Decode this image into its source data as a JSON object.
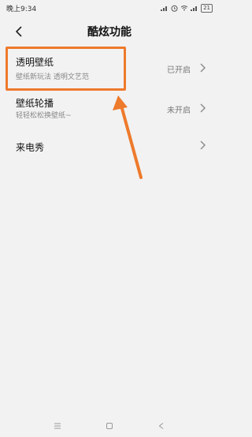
{
  "status_bar": {
    "time": "晚上9:34",
    "battery": "21",
    "icons": [
      "alarm-icon",
      "wifi-icon",
      "signal-icon",
      "signal-icon-2",
      "battery-icon"
    ]
  },
  "header": {
    "title": "酷炫功能",
    "back_icon": "chevron-left-icon"
  },
  "settings": [
    {
      "title": "透明壁纸",
      "subtitle": "壁纸新玩法 透明文艺范",
      "status": "已开启"
    },
    {
      "title": "壁纸轮播",
      "subtitle": "轻轻松松换壁纸~",
      "status": "未开启"
    },
    {
      "title": "来电秀",
      "subtitle": "",
      "status": ""
    }
  ],
  "annotation": {
    "highlight_color": "#ee7a2c",
    "arrow_color": "#ee7a2c"
  },
  "nav_bar": {
    "icons": [
      "menu-icon",
      "home-icon",
      "back-icon"
    ]
  },
  "colors": {
    "background": "#f2f2f2",
    "accent": "#ee7a2c"
  }
}
